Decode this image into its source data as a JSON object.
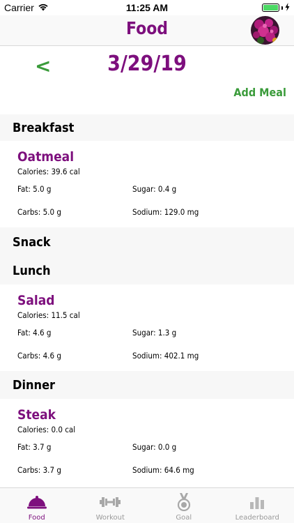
{
  "status_bar": {
    "carrier": "Carrier",
    "time": "11:25 AM",
    "battery_level": 1.0,
    "battery_color": "#4cd964"
  },
  "nav": {
    "title": "Food",
    "avatar_icon": "flower-photo-avatar"
  },
  "date_row": {
    "back_symbol": "<",
    "date": "3/29/19",
    "add_meal": "Add Meal"
  },
  "meals": [
    {
      "name": "Breakfast",
      "items": [
        {
          "food": "Oatmeal",
          "calories": "Calories: 39.6 cal",
          "fat": "Fat: 5.0 g",
          "sugar": "Sugar: 0.4 g",
          "carbs": "Carbs: 5.0 g",
          "sodium": "Sodium: 129.0 mg"
        }
      ]
    },
    {
      "name": "Snack",
      "items": []
    },
    {
      "name": "Lunch",
      "items": [
        {
          "food": "Salad",
          "calories": "Calories: 11.5 cal",
          "fat": "Fat: 4.6 g",
          "sugar": "Sugar: 1.3 g",
          "carbs": "Carbs: 4.6 g",
          "sodium": "Sodium: 402.1 mg"
        }
      ]
    },
    {
      "name": "Dinner",
      "items": [
        {
          "food": "Steak",
          "calories": "Calories: 0.0 cal",
          "fat": "Fat: 3.7 g",
          "sugar": "Sugar: 0.0 g",
          "carbs": "Carbs: 3.7 g",
          "sodium": "Sodium: 64.6 mg"
        }
      ]
    }
  ],
  "tabs": [
    {
      "label": "Food",
      "icon": "food-dome-icon",
      "active": true
    },
    {
      "label": "Workout",
      "icon": "dumbbell-icon",
      "active": false
    },
    {
      "label": "Goal",
      "icon": "medal-icon",
      "active": false
    },
    {
      "label": "Leaderboard",
      "icon": "bar-chart-icon",
      "active": false
    }
  ],
  "colors": {
    "brand_purple": "#7d0f7d",
    "accent_green": "#3a9b3a",
    "inactive_gray": "#9a9a9a"
  }
}
